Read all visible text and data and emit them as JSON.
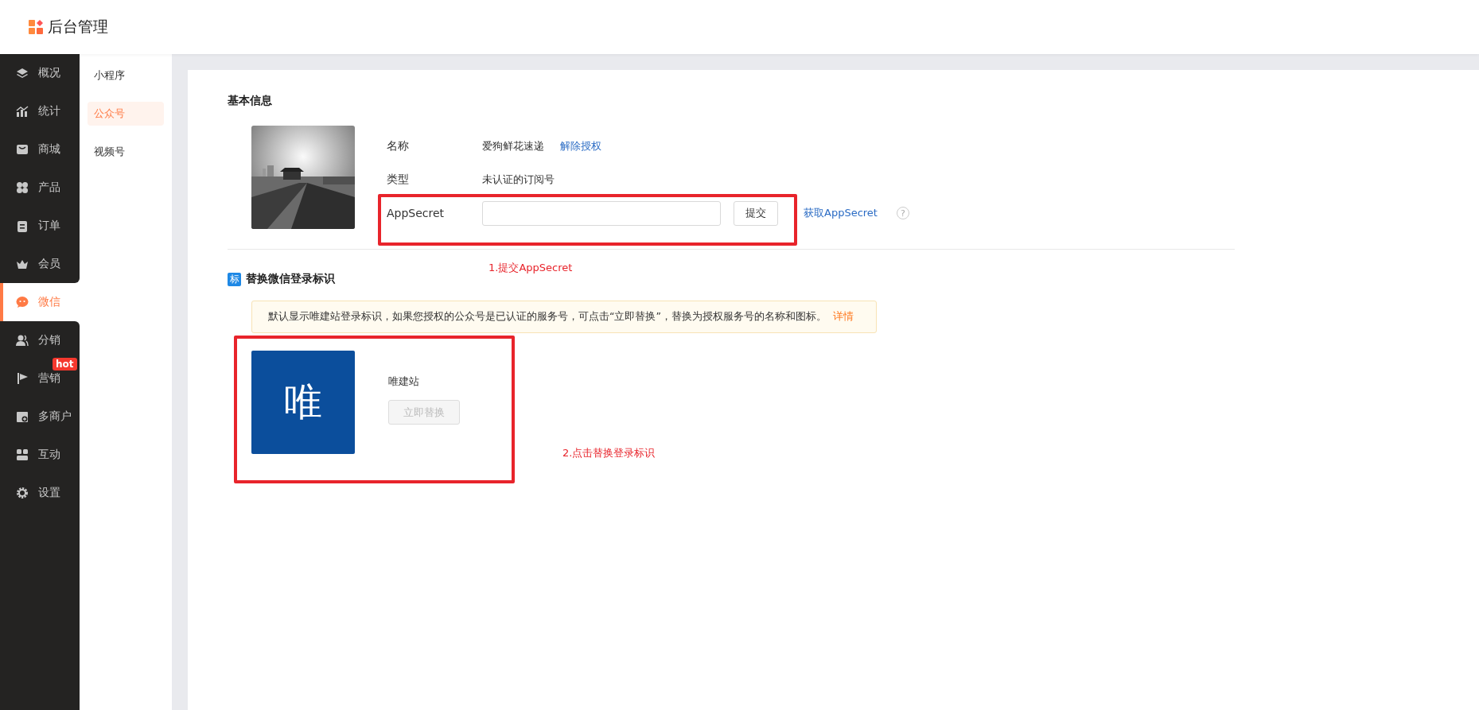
{
  "header": {
    "title": "后台管理"
  },
  "sidebar": {
    "items": [
      {
        "label": "概况",
        "selected": false
      },
      {
        "label": "统计",
        "selected": false
      },
      {
        "label": "商城",
        "selected": false
      },
      {
        "label": "产品",
        "selected": false
      },
      {
        "label": "订单",
        "selected": false
      },
      {
        "label": "会员",
        "selected": false
      },
      {
        "label": "微信",
        "selected": true
      },
      {
        "label": "分销",
        "selected": false
      },
      {
        "label": "营销",
        "selected": false,
        "badge": "hot"
      },
      {
        "label": "多商户",
        "selected": false
      },
      {
        "label": "互动",
        "selected": false
      },
      {
        "label": "设置",
        "selected": false
      }
    ]
  },
  "submenu": {
    "items": [
      {
        "label": "小程序",
        "selected": false
      },
      {
        "label": "公众号",
        "selected": true
      },
      {
        "label": "视频号",
        "selected": false
      }
    ]
  },
  "basic_info": {
    "title": "基本信息",
    "name_label": "名称",
    "name_value": "爱狗鲜花速递",
    "unauthorize_link": "解除授权",
    "type_label": "类型",
    "type_value": "未认证的订阅号",
    "secret_label": "AppSecret",
    "submit_button": "提交",
    "get_secret_link": "获取AppSecret",
    "help": "?"
  },
  "login_mark": {
    "badge": "标",
    "title": "替换微信登录标识",
    "notice": "默认显示唯建站登录标识，如果您授权的公众号是已认证的服务号，可点击“立即替换”，替换为授权服务号的名称和图标。",
    "notice_link": "详情",
    "logo_char": "唯",
    "site_name": "唯建站",
    "replace_button": "立即替换",
    "replace_disabled": true
  },
  "annotations": [
    {
      "text": "1.提交AppSecret"
    },
    {
      "text": "2.点击替换登录标识"
    }
  ]
}
